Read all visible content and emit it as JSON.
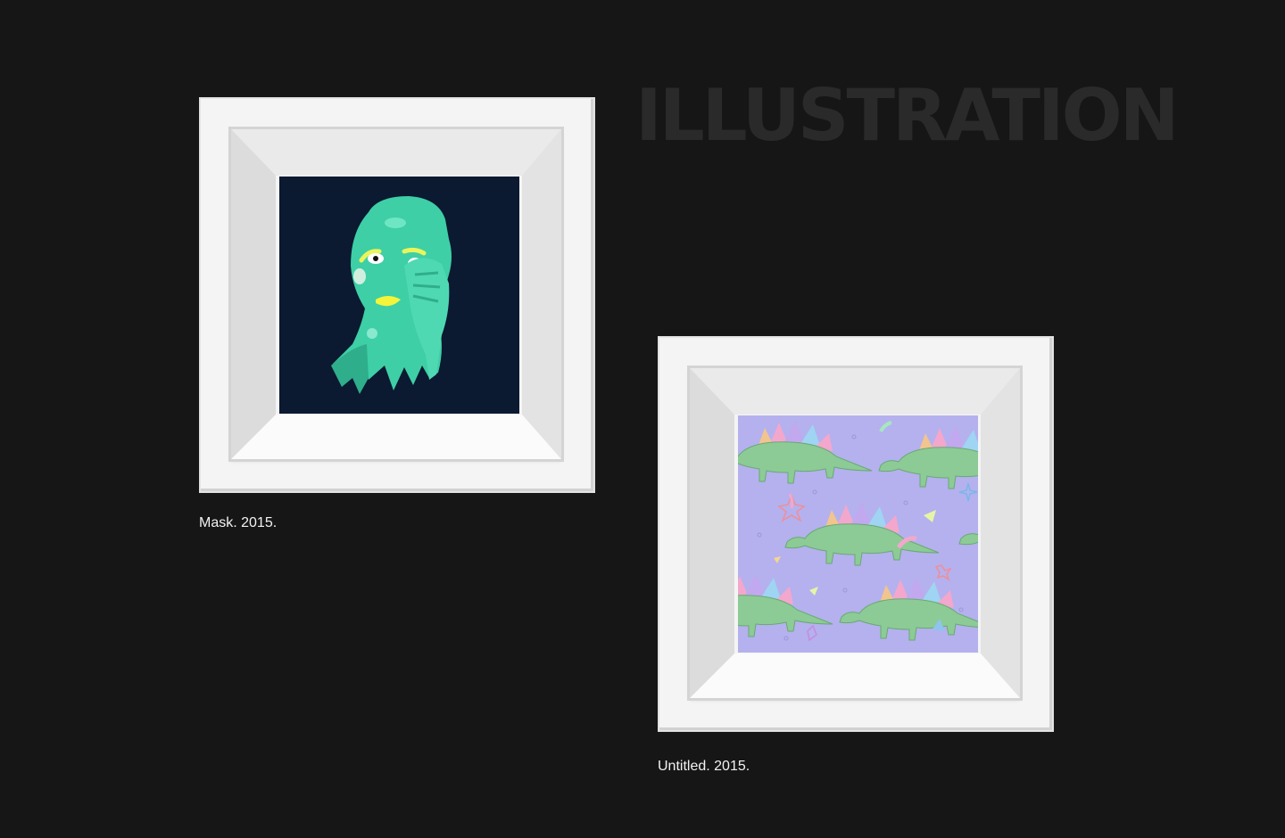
{
  "section": {
    "title": "ILLUSTRATION"
  },
  "artworks": [
    {
      "caption": "Mask. 2015.",
      "icon": "mask-illustration",
      "background": "#0b1931",
      "accent": "#3ecfa6"
    },
    {
      "caption": "Untitled. 2015.",
      "icon": "stegosaurus-pattern",
      "background": "#b4b1ee",
      "accent": "#8ccb95"
    }
  ]
}
